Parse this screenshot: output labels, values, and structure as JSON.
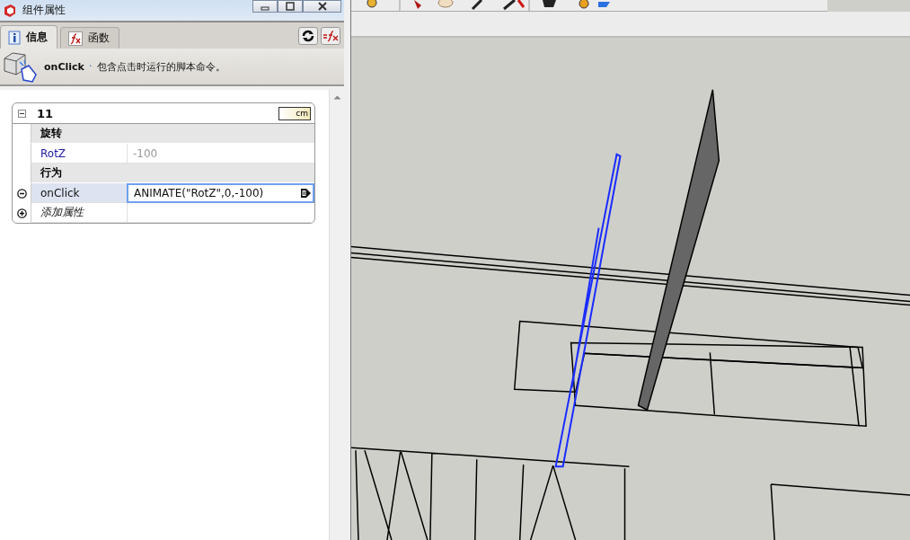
{
  "window": {
    "title": "组件属性"
  },
  "tabs": [
    {
      "label": "信息",
      "selected": true
    },
    {
      "label": "函数",
      "selected": false
    }
  ],
  "info": {
    "attribute": "onClick",
    "separator": "·",
    "description": "包含点击时运行的脚本命令。"
  },
  "component": {
    "name": "11",
    "unit": "cm",
    "expanded": true
  },
  "rows": [
    {
      "kind": "group",
      "label": "旋转"
    },
    {
      "kind": "attribute",
      "name": "RotZ",
      "value": "-100",
      "selected": false
    },
    {
      "kind": "group",
      "label": "行为"
    },
    {
      "kind": "attribute",
      "name": "onClick",
      "value": "ANIMATE(\"RotZ\",0,-100)",
      "selected": true
    },
    {
      "kind": "add",
      "label": "添加属性"
    }
  ]
}
